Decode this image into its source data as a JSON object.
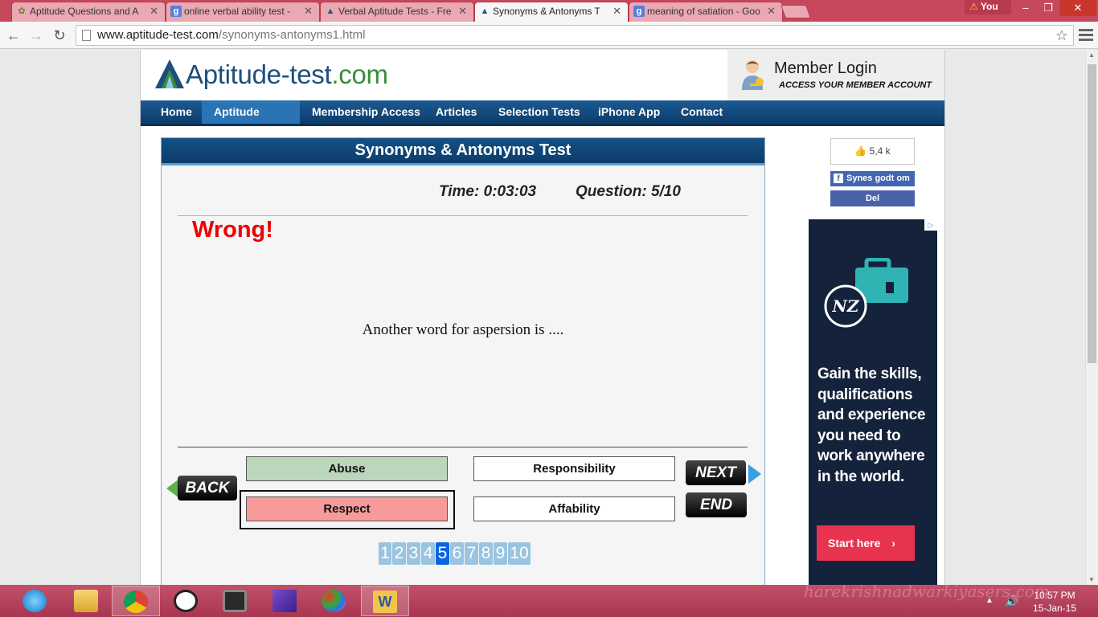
{
  "browser": {
    "tabs": [
      {
        "label": "Aptitude Questions and A",
        "icon": "palm-icon"
      },
      {
        "label": "online verbal ability test -",
        "icon": "google-icon"
      },
      {
        "label": "Verbal Aptitude Tests - Fre",
        "icon": "aptitude-logo-icon"
      },
      {
        "label": "Synonyms & Antonyms T",
        "icon": "aptitude-logo-icon",
        "active": true
      },
      {
        "label": "meaning of satiation - Goo",
        "icon": "google-icon"
      }
    ],
    "user": "You",
    "url_host": "www.aptitude-test.com",
    "url_path": "/synonyms-antonyms1.html"
  },
  "site": {
    "logo": {
      "name": "Aptitude-test",
      "tld": ".com"
    },
    "member": {
      "title": "Member Login",
      "subtitle": "ACCESS YOUR MEMBER ACCOUNT"
    },
    "nav": [
      "Home",
      "Aptitude Tests",
      "Membership Access",
      "Articles",
      "Selection Tests",
      "iPhone App",
      "Contact"
    ],
    "nav_active": "Aptitude Tests"
  },
  "quiz": {
    "title": "Synonyms & Antonyms Test",
    "time_label": "Time:",
    "time_value": "0:03:03",
    "question_label": "Question:",
    "question_value": "5/10",
    "feedback": "Wrong!",
    "question": "Another word for aspersion is ....",
    "answers": [
      {
        "text": "Abuse",
        "state": "correct"
      },
      {
        "text": "Responsibility",
        "state": "none"
      },
      {
        "text": "Respect",
        "state": "wrong-selected"
      },
      {
        "text": "Affability",
        "state": "none"
      }
    ],
    "back_label": "BACK",
    "next_label": "NEXT",
    "end_label": "END",
    "pages": [
      "1",
      "2",
      "3",
      "4",
      "5",
      "6",
      "7",
      "8",
      "9",
      "10"
    ],
    "current_page": "5"
  },
  "social": {
    "like_count": "5,4 k",
    "like_label": "Synes godt om",
    "share_label": "Del"
  },
  "ad": {
    "logo": "NZ",
    "copy": "Gain the skills, qualifications and experience you need to work anywhere in the world.",
    "cta": "Start here"
  },
  "taskbar": {
    "watermark": "harekrishnadwarkiyasers.com",
    "time": "10:57 PM",
    "date": "15-Jan-15"
  },
  "colors": {
    "tabstrip": "#c7475d",
    "nav": "#0b3c6a",
    "correct": "#bcd6bc",
    "wrong": "#f79a9a",
    "current_page": "#0d64e0",
    "ad_bg": "#14223b",
    "ad_cta": "#e8334e"
  }
}
